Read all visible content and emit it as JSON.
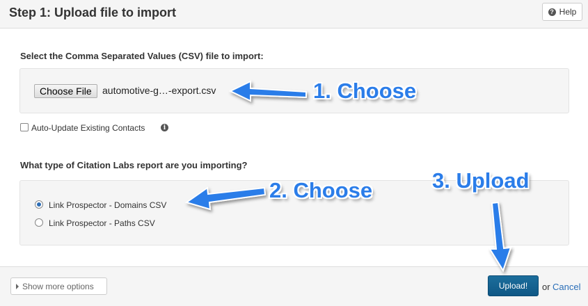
{
  "header": {
    "title": "Step 1: Upload file to import",
    "help_label": "Help"
  },
  "file_section": {
    "label": "Select the Comma Separated Values (CSV) file to import:",
    "choose_file_label": "Choose File",
    "file_name": "automotive-g…-export.csv"
  },
  "options": {
    "auto_update_label": "Auto-Update Existing Contacts",
    "auto_update_checked": false
  },
  "report_section": {
    "label": "What type of Citation Labs report are you importing?",
    "radios": [
      {
        "label": "Link Prospector - Domains CSV",
        "checked": true
      },
      {
        "label": "Link Prospector - Paths CSV",
        "checked": false
      }
    ]
  },
  "footer": {
    "show_more_label": "Show more options",
    "upload_label": "Upload!",
    "or_text": "or",
    "cancel_label": "Cancel"
  },
  "annotations": {
    "step1": "1. Choose",
    "step2": "2. Choose",
    "step3": "3. Upload",
    "arrow_color": "#2b7de9"
  },
  "icons": {
    "help": "question-circle-icon",
    "info": "info-circle-icon",
    "more": "caret-right-icon"
  }
}
